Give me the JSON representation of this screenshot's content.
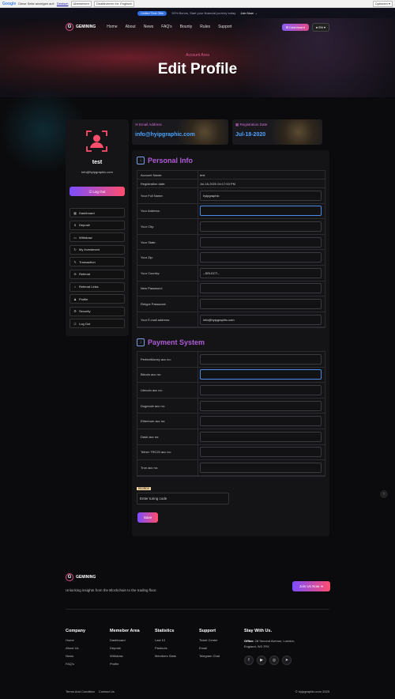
{
  "translate_bar": {
    "prefix": "Diese Seite anzeigen auf:",
    "language": "Deutsch",
    "translate_btn": "Übersetzen",
    "disable_btn": "Deaktivieren für: Englisch",
    "options": "Optionen ▾"
  },
  "promo": {
    "tag": "Limited Time Offer",
    "text": "50% Bonus, Start your financial journey today",
    "join": "Join Now →"
  },
  "nav": {
    "brand": "GEMINING",
    "logo_letter": "G",
    "items": [
      "Home",
      "About",
      "News",
      "FAQ's",
      "Bounty",
      "Rules",
      "Support"
    ],
    "dashboard": "⊞ Dashboard",
    "lang": "● EN ▾"
  },
  "hero": {
    "subtitle": "Account Area",
    "title": "Edit Profile"
  },
  "profile": {
    "name": "test",
    "email": "info@hyipgraphic.com",
    "logout": "⎋ Log Out"
  },
  "sidebar": [
    {
      "icon": "▦",
      "label": "Dashboard"
    },
    {
      "icon": "$",
      "label": "Deposit"
    },
    {
      "icon": "▭",
      "label": "Withdraw"
    },
    {
      "icon": "↻",
      "label": "My Investment"
    },
    {
      "icon": "✎",
      "label": "Transaction"
    },
    {
      "icon": "⊕",
      "label": "Referral"
    },
    {
      "icon": "<",
      "label": "Referral Links"
    },
    {
      "icon": "♟",
      "label": "Profile"
    },
    {
      "icon": "⚙",
      "label": "Security"
    },
    {
      "icon": "⎋",
      "label": "Log Out"
    }
  ],
  "cards": {
    "email_label": "✉ Email Address",
    "email_value": "info@hyipgraphic.com",
    "reg_label": "▦ Registration Date",
    "reg_value": "Jul-18-2020"
  },
  "personal": {
    "title": "Personal Info",
    "rows": [
      {
        "label": "Account Name:",
        "value": "test",
        "type": "text"
      },
      {
        "label": "Registration date:",
        "value": "Jul-18-2020 04:17:53 PM",
        "type": "text"
      },
      {
        "label": "Your Full Name:",
        "value": "hyipgraphic",
        "type": "input"
      },
      {
        "label": "Your Address:",
        "value": "",
        "type": "input",
        "focus": true
      },
      {
        "label": "Your City:",
        "value": "",
        "type": "input"
      },
      {
        "label": "Your State:",
        "value": "",
        "type": "input"
      },
      {
        "label": "Your Zip:",
        "value": "",
        "type": "input"
      },
      {
        "label": "Your Country:",
        "value": "--SELECT--",
        "type": "input"
      },
      {
        "label": "New Password:",
        "value": "",
        "type": "input"
      },
      {
        "label": "Retype Password:",
        "value": "",
        "type": "input"
      },
      {
        "label": "Your E-mail address:",
        "value": "info@hyipgraphic.com",
        "type": "input"
      }
    ]
  },
  "payment": {
    "title": "Payment System",
    "rows": [
      {
        "label": "PerfectMoney acc no:",
        "value": ""
      },
      {
        "label": "Bitcoin acc no:",
        "value": "",
        "focus": true
      },
      {
        "label": "Litecoin acc no:",
        "value": ""
      },
      {
        "label": "Dogecoin acc no:",
        "value": ""
      },
      {
        "label": "Ethereum acc no:",
        "value": ""
      },
      {
        "label": "Dash acc no:",
        "value": ""
      },
      {
        "label": "Tether TRC20 acc no:",
        "value": ""
      },
      {
        "label": "Tron acc no:",
        "value": ""
      }
    ]
  },
  "captcha": {
    "image_text": "RE2RD9",
    "placeholder": "Enter turing code"
  },
  "save": "Save",
  "footer": {
    "brand": "GEMINING",
    "desc": "Unlocking insights from the Blockchain to the trading floor.",
    "join": "Join Us Now ➜",
    "cols": [
      {
        "title": "Company",
        "links": [
          "Home",
          "About Us",
          "News",
          "FAQ's"
        ]
      },
      {
        "title": "Memeber Area",
        "links": [
          "Dashboard",
          "Deposit",
          "Withdraw",
          "Profile"
        ]
      },
      {
        "title": "Statistics",
        "links": [
          "Last 10",
          "Paidouts",
          "Members Stats"
        ]
      },
      {
        "title": "Support",
        "links": [
          "Ticket Center",
          "Email",
          "Telegram Chat"
        ]
      }
    ],
    "stay": {
      "title": "Stay With Us.",
      "office_label": "Office:",
      "office": "28 Second Avenue, London, England, W3 7RX"
    },
    "social": [
      "f",
      "▶",
      "◎",
      "➤"
    ],
    "terms": "Terms And Condition",
    "contact": "Contact Us",
    "copyright": "© hyipgraphic.com 2025"
  }
}
